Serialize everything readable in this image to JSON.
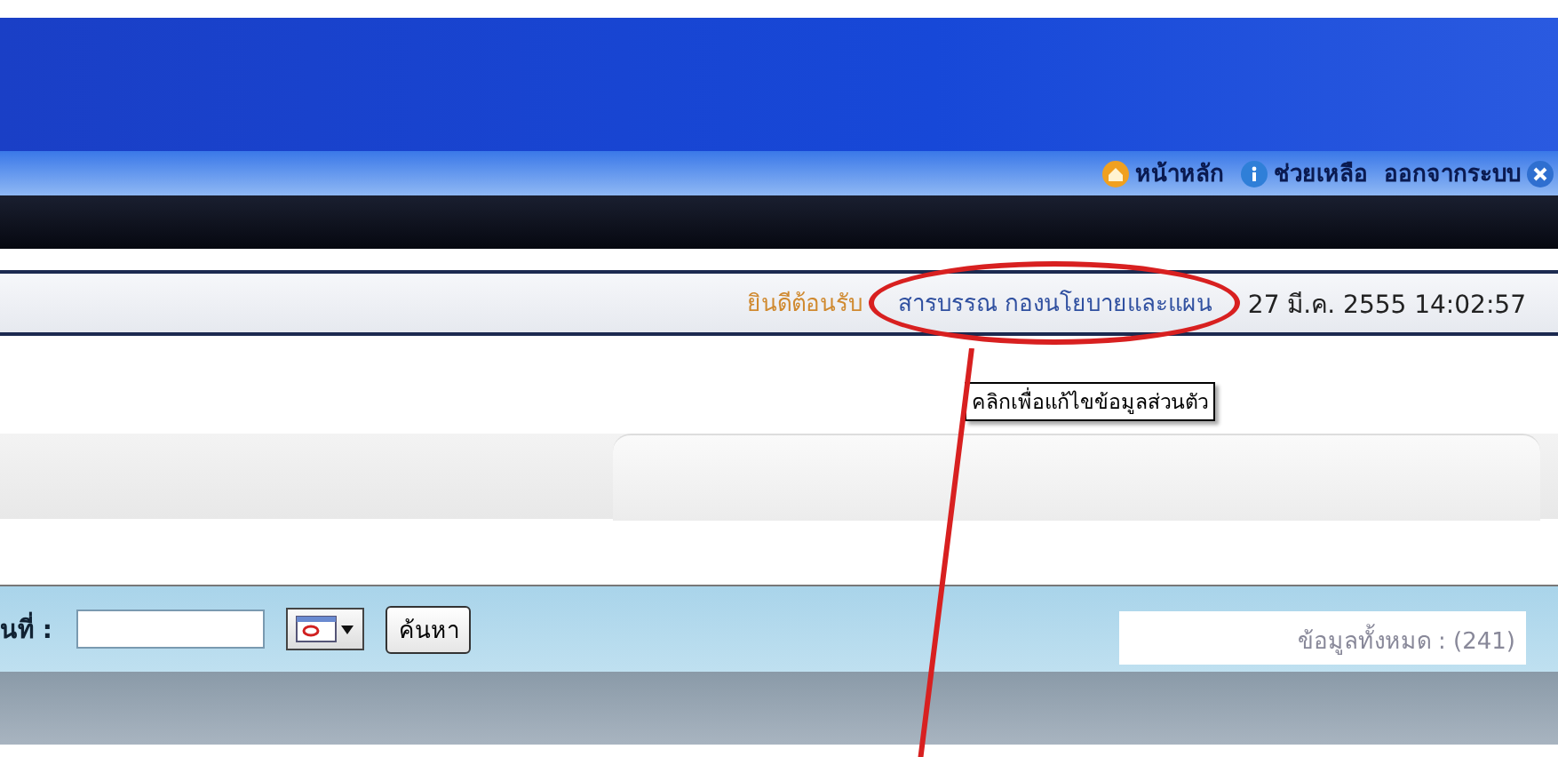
{
  "header": {
    "links": [
      {
        "kind": "home",
        "label": "หน้าหลัก"
      },
      {
        "kind": "help",
        "label": "ช่วยเหลือ"
      },
      {
        "kind": "logout",
        "label": "ออกจากระบบ"
      }
    ]
  },
  "welcome": {
    "greeting": "ยินดีต้อนรับ",
    "user": "สารบรรณ กองนโยบายและแผน",
    "datetime": "27 มี.ค. 2555 14:02:57"
  },
  "tooltip": "คลิกเพื่อแก้ไขข้อมูลส่วนตัว",
  "search": {
    "label": "นที่ :",
    "button": "ค้นหา",
    "total": "ข้อมูลทั้งหมด : (241)"
  }
}
